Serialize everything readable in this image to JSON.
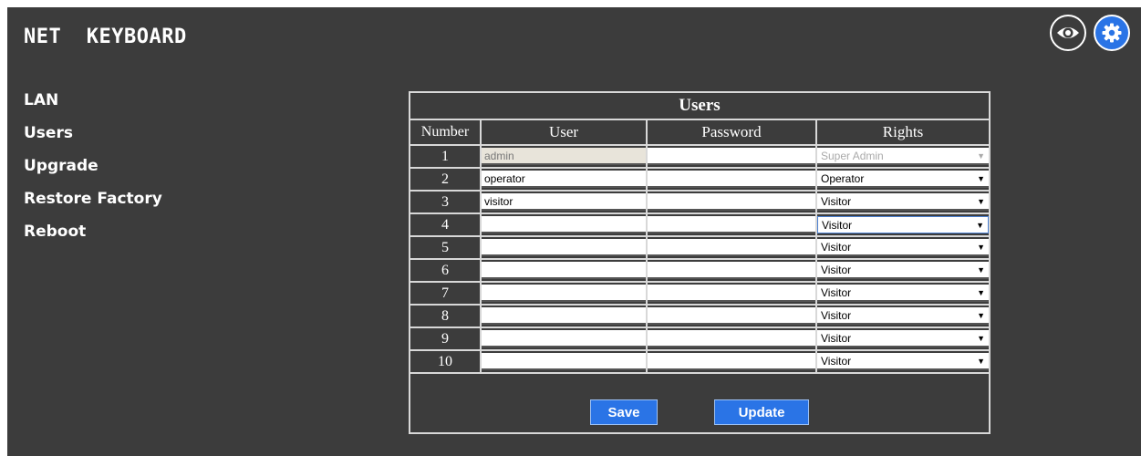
{
  "app": {
    "title": "NET  KEYBOARD",
    "accent": "#2a74e6",
    "background": "#3c3c3c"
  },
  "top_icons": [
    {
      "name": "eye-icon"
    },
    {
      "name": "gear-icon"
    }
  ],
  "sidebar": {
    "items": [
      {
        "label": "LAN"
      },
      {
        "label": "Users"
      },
      {
        "label": "Upgrade"
      },
      {
        "label": "Restore Factory"
      },
      {
        "label": "Reboot"
      }
    ]
  },
  "users_table": {
    "caption": "Users",
    "headers": {
      "number": "Number",
      "user": "User",
      "password": "Password",
      "rights": "Rights"
    },
    "rows": [
      {
        "number": "1",
        "user": "admin",
        "password": "",
        "rights": "Super Admin"
      },
      {
        "number": "2",
        "user": "operator",
        "password": "",
        "rights": "Operator"
      },
      {
        "number": "3",
        "user": "visitor",
        "password": "",
        "rights": "Visitor"
      },
      {
        "number": "4",
        "user": "",
        "password": "",
        "rights": "Visitor"
      },
      {
        "number": "5",
        "user": "",
        "password": "",
        "rights": "Visitor"
      },
      {
        "number": "6",
        "user": "",
        "password": "",
        "rights": "Visitor"
      },
      {
        "number": "7",
        "user": "",
        "password": "",
        "rights": "Visitor"
      },
      {
        "number": "8",
        "user": "",
        "password": "",
        "rights": "Visitor"
      },
      {
        "number": "9",
        "user": "",
        "password": "",
        "rights": "Visitor"
      },
      {
        "number": "10",
        "user": "",
        "password": "",
        "rights": "Visitor"
      }
    ]
  },
  "actions": {
    "save_label": "Save",
    "update_label": "Update"
  }
}
